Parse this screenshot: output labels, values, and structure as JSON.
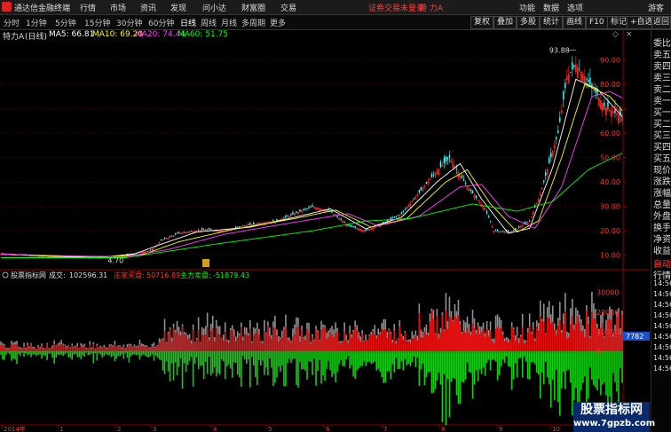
{
  "menubar": {
    "app_name": "通达信金融终端",
    "menus": [
      "行情",
      "市场",
      "资讯",
      "发现",
      "问小达",
      "财富圈",
      "交易"
    ],
    "warning": "证券交易未登录",
    "stock": "特 力A",
    "buttons": [
      "功能",
      "数据",
      "选项",
      "游客"
    ]
  },
  "toolbar": {
    "periods": [
      "分时",
      "1分钟",
      "5分钟",
      "15分钟",
      "30分钟",
      "60分钟",
      "日线",
      "周线",
      "月线",
      "多周期",
      "更多"
    ],
    "active_period": "日线",
    "right_buttons": [
      "复权",
      "叠加",
      "多股",
      "统计",
      "画线",
      "F10",
      "标记",
      "+自选",
      "返回"
    ]
  },
  "title": {
    "stock": "特力A",
    "period": "(日线)",
    "ma5": "MA5: 66.81",
    "ma10": "MA10: 69.20",
    "ma20": "MA20: 74.44",
    "ma60": "MA60: 51.75"
  },
  "colors": {
    "up": "#ff3232",
    "down": "#54ffff",
    "ma5": "#ffffff",
    "ma10": "#ffff00",
    "ma20": "#ff40ff",
    "ma60": "#00ff00",
    "buy": "#e01010",
    "sell": "#10d010",
    "gray": "#909090"
  },
  "chart_data": {
    "type": "candlestick",
    "y_ticks": [
      "90.00",
      "80.00",
      "70.00",
      "60.00",
      "50.00",
      "40.00",
      "30.00",
      "20.00",
      "10.00"
    ],
    "ylim": [
      7,
      97
    ],
    "high_marker": "93.88",
    "low_marker": "4.70",
    "months": [
      "2014年",
      "1",
      "2",
      "3",
      "4",
      "5",
      "6",
      "7",
      "8",
      "9",
      "10",
      "11"
    ],
    "close_path": [
      [
        0,
        10.5
      ],
      [
        20,
        9.7
      ],
      [
        40,
        9.2
      ],
      [
        55,
        9.0
      ],
      [
        62,
        9.0
      ],
      [
        75,
        10.8
      ],
      [
        85,
        12.0
      ],
      [
        90,
        16.0
      ],
      [
        100,
        19.0
      ],
      [
        115,
        20.5
      ],
      [
        125,
        20.0
      ],
      [
        140,
        22.5
      ],
      [
        155,
        24.0
      ],
      [
        165,
        27.0
      ],
      [
        175,
        29.8
      ],
      [
        185,
        28.0
      ],
      [
        195,
        22.0
      ],
      [
        205,
        20.0
      ],
      [
        215,
        23.0
      ],
      [
        225,
        27.0
      ],
      [
        232,
        33.0
      ],
      [
        242,
        42.0
      ],
      [
        252,
        50.0
      ],
      [
        257,
        44.0
      ],
      [
        262,
        38.0
      ],
      [
        272,
        29.0
      ],
      [
        277,
        20.0
      ],
      [
        287,
        19.5
      ],
      [
        297,
        24.0
      ],
      [
        303,
        35.0
      ],
      [
        313,
        60.0
      ],
      [
        318,
        83.0
      ],
      [
        323,
        88.0
      ],
      [
        330,
        81.0
      ],
      [
        340,
        70.0
      ],
      [
        349,
        66.8
      ]
    ],
    "ma5_path": [
      [
        0,
        10.6
      ],
      [
        30,
        9.5
      ],
      [
        55,
        9.1
      ],
      [
        75,
        10.5
      ],
      [
        90,
        14.5
      ],
      [
        110,
        19.5
      ],
      [
        140,
        21.5
      ],
      [
        165,
        25.5
      ],
      [
        185,
        29.0
      ],
      [
        205,
        20.8
      ],
      [
        225,
        25.5
      ],
      [
        245,
        40.0
      ],
      [
        258,
        47.5
      ],
      [
        270,
        33.0
      ],
      [
        285,
        19.0
      ],
      [
        297,
        21.0
      ],
      [
        310,
        46.0
      ],
      [
        323,
        82.0
      ],
      [
        335,
        78.0
      ],
      [
        349,
        66.8
      ]
    ],
    "ma10_path": [
      [
        0,
        10.6
      ],
      [
        30,
        9.6
      ],
      [
        55,
        9.2
      ],
      [
        80,
        10.3
      ],
      [
        100,
        15.5
      ],
      [
        130,
        20.5
      ],
      [
        165,
        25.0
      ],
      [
        188,
        28.5
      ],
      [
        208,
        21.5
      ],
      [
        228,
        25.0
      ],
      [
        250,
        40.0
      ],
      [
        262,
        45.0
      ],
      [
        275,
        31.0
      ],
      [
        290,
        19.5
      ],
      [
        302,
        24.0
      ],
      [
        315,
        50.0
      ],
      [
        328,
        80.0
      ],
      [
        342,
        75.0
      ],
      [
        349,
        69.2
      ]
    ],
    "ma20_path": [
      [
        0,
        10.5
      ],
      [
        40,
        9.7
      ],
      [
        70,
        9.4
      ],
      [
        95,
        12.5
      ],
      [
        125,
        18.5
      ],
      [
        165,
        23.5
      ],
      [
        195,
        27.0
      ],
      [
        212,
        22.0
      ],
      [
        235,
        26.0
      ],
      [
        258,
        38.0
      ],
      [
        270,
        39.0
      ],
      [
        285,
        26.0
      ],
      [
        300,
        21.0
      ],
      [
        315,
        38.0
      ],
      [
        332,
        75.0
      ],
      [
        342,
        77.0
      ],
      [
        349,
        74.4
      ]
    ],
    "ma60_path": [
      [
        0,
        9.0
      ],
      [
        70,
        9.0
      ],
      [
        120,
        14.5
      ],
      [
        175,
        20.0
      ],
      [
        205,
        24.0
      ],
      [
        230,
        25.0
      ],
      [
        265,
        31.0
      ],
      [
        290,
        28.0
      ],
      [
        310,
        32.0
      ],
      [
        330,
        45.0
      ],
      [
        349,
        51.75
      ]
    ]
  },
  "indicator": {
    "name": "股票指标网",
    "turnover_label": "成交:",
    "turnover": "102596.31",
    "dealer_buy_label": "庄家买盘:",
    "dealer_buy": "50716.89",
    "main_sell_label": "主力卖盘:",
    "main_sell": "-51879.43",
    "y_ticks": [
      "30000",
      "20000",
      "10000",
      "0"
    ],
    "ylim": [
      -35000,
      37000
    ],
    "current_tag": "7782"
  },
  "right_panel": {
    "items": [
      "委比",
      "卖五",
      "卖四",
      "卖三",
      "卖二",
      "卖一",
      "买一",
      "买二",
      "买三",
      "买四",
      "买五",
      "现价",
      "涨跌",
      "涨幅",
      "总量",
      "外盘",
      "换手",
      "净资",
      "收益"
    ],
    "tab": "自动",
    "tab2": "行情",
    "times": [
      "14:56",
      "14:56",
      "14:56",
      "14:56",
      "14:56",
      "14:56",
      "14:56",
      "14:56",
      "14:56"
    ]
  },
  "watermark": {
    "title": "股票指标网",
    "url": "www.7gpzb.com"
  }
}
